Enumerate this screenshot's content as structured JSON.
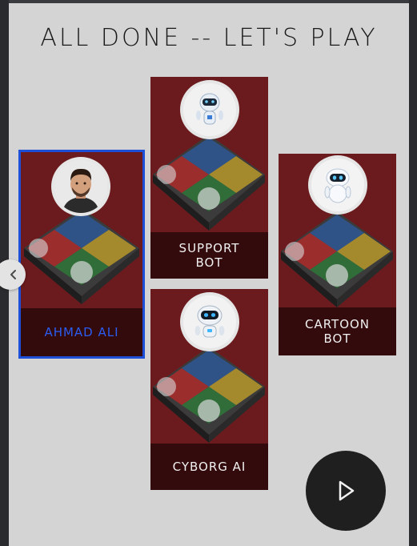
{
  "title": "ALL DONE -- LET'S PLAY",
  "players": [
    {
      "name": "AHMAD ALI",
      "avatar": "man-avatar-icon",
      "selected": true
    },
    {
      "name": "SUPPORT BOT",
      "avatar": "support-robot-icon",
      "selected": false
    },
    {
      "name": "CARTOON BOT",
      "avatar": "cartoon-robot-icon",
      "selected": false
    },
    {
      "name": "CYBORG AI",
      "avatar": "cyborg-robot-icon",
      "selected": false
    }
  ],
  "controls": {
    "prev_icon": "chevron-left-icon",
    "play_icon": "play-icon"
  },
  "colors": {
    "card_bg": "#6e1a1c",
    "selected_border": "#1d4fd8",
    "selected_text": "#2b5cf0",
    "play_bg": "#1f1f1f"
  }
}
